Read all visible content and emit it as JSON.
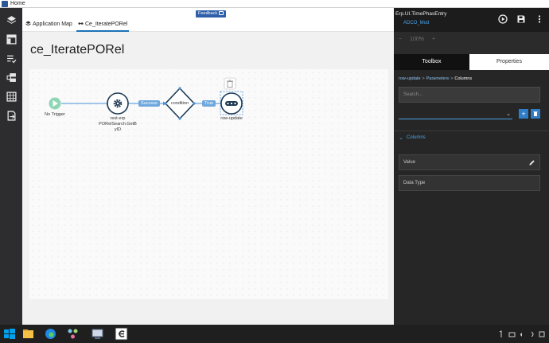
{
  "window": {
    "title": "Home"
  },
  "main": {
    "tabs": [
      {
        "label": "Application Map"
      },
      {
        "label": "Ce_IteratePORel"
      }
    ],
    "feedback_label": "Feedback",
    "page_title": "ce_IteratePORel"
  },
  "flow": {
    "nodes": [
      {
        "label": "No Trigger"
      },
      {
        "label_lines": [
          "rest-erp",
          "PORelSearch.GetB",
          "yID"
        ]
      },
      {
        "label": "condition"
      },
      {
        "label": "row-update"
      }
    ],
    "connectors": [
      {
        "label": "Success"
      },
      {
        "label": "True"
      }
    ]
  },
  "right_panel": {
    "entity": "Erp.UI.TimePhasEntry",
    "version": "ADCO_Mod",
    "zoom": {
      "minus": "−",
      "value": "100%",
      "plus": "+"
    },
    "tabs": [
      {
        "label": "Toolbox"
      },
      {
        "label": "Properties"
      }
    ],
    "breadcrumb": [
      "row-update",
      "Parameters",
      "Columns"
    ],
    "breadcrumb_sep": ">",
    "search_placeholder": "Search...",
    "add_label": "+",
    "section_title": "Columns",
    "fields": [
      {
        "label": "Value"
      },
      {
        "label": "Data Type"
      }
    ]
  },
  "colors": {
    "accent": "#2f7dc7",
    "node_stroke": "#1f3b55",
    "trigger": "#8fd6b4",
    "pill": "#6fa8dc"
  }
}
